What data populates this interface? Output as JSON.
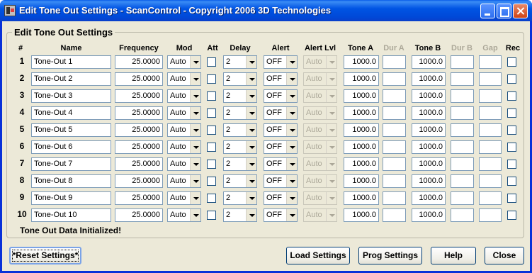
{
  "window": {
    "title": "Edit Tone Out Settings - ScanControl - Copyright 2006 3D Technologies"
  },
  "group": {
    "title": "Edit Tone Out Settings"
  },
  "headers": {
    "num": "#",
    "name": "Name",
    "frequency": "Frequency",
    "mod": "Mod",
    "att": "Att",
    "delay": "Delay",
    "alert": "Alert",
    "alert_lvl": "Alert Lvl",
    "tone_a": "Tone A",
    "dur_a": "Dur A",
    "tone_b": "Tone B",
    "dur_b": "Dur B",
    "gap": "Gap",
    "rec": "Rec"
  },
  "rows": [
    {
      "num": "1",
      "name": "Tone-Out 1",
      "frequency": "25.0000",
      "mod": "Auto",
      "delay": "2",
      "alert": "OFF",
      "alert_lvl": "Auto",
      "tone_a": "1000.0",
      "dur_a": "",
      "tone_b": "1000.0",
      "dur_b": "",
      "gap": ""
    },
    {
      "num": "2",
      "name": "Tone-Out 2",
      "frequency": "25.0000",
      "mod": "Auto",
      "delay": "2",
      "alert": "OFF",
      "alert_lvl": "Auto",
      "tone_a": "1000.0",
      "dur_a": "",
      "tone_b": "1000.0",
      "dur_b": "",
      "gap": ""
    },
    {
      "num": "3",
      "name": "Tone-Out 3",
      "frequency": "25.0000",
      "mod": "Auto",
      "delay": "2",
      "alert": "OFF",
      "alert_lvl": "Auto",
      "tone_a": "1000.0",
      "dur_a": "",
      "tone_b": "1000.0",
      "dur_b": "",
      "gap": ""
    },
    {
      "num": "4",
      "name": "Tone-Out 4",
      "frequency": "25.0000",
      "mod": "Auto",
      "delay": "2",
      "alert": "OFF",
      "alert_lvl": "Auto",
      "tone_a": "1000.0",
      "dur_a": "",
      "tone_b": "1000.0",
      "dur_b": "",
      "gap": ""
    },
    {
      "num": "5",
      "name": "Tone-Out 5",
      "frequency": "25.0000",
      "mod": "Auto",
      "delay": "2",
      "alert": "OFF",
      "alert_lvl": "Auto",
      "tone_a": "1000.0",
      "dur_a": "",
      "tone_b": "1000.0",
      "dur_b": "",
      "gap": ""
    },
    {
      "num": "6",
      "name": "Tone-Out 6",
      "frequency": "25.0000",
      "mod": "Auto",
      "delay": "2",
      "alert": "OFF",
      "alert_lvl": "Auto",
      "tone_a": "1000.0",
      "dur_a": "",
      "tone_b": "1000.0",
      "dur_b": "",
      "gap": ""
    },
    {
      "num": "7",
      "name": "Tone-Out 7",
      "frequency": "25.0000",
      "mod": "Auto",
      "delay": "2",
      "alert": "OFF",
      "alert_lvl": "Auto",
      "tone_a": "1000.0",
      "dur_a": "",
      "tone_b": "1000.0",
      "dur_b": "",
      "gap": ""
    },
    {
      "num": "8",
      "name": "Tone-Out 8",
      "frequency": "25.0000",
      "mod": "Auto",
      "delay": "2",
      "alert": "OFF",
      "alert_lvl": "Auto",
      "tone_a": "1000.0",
      "dur_a": "",
      "tone_b": "1000.0",
      "dur_b": "",
      "gap": ""
    },
    {
      "num": "9",
      "name": "Tone-Out 9",
      "frequency": "25.0000",
      "mod": "Auto",
      "delay": "2",
      "alert": "OFF",
      "alert_lvl": "Auto",
      "tone_a": "1000.0",
      "dur_a": "",
      "tone_b": "1000.0",
      "dur_b": "",
      "gap": ""
    },
    {
      "num": "10",
      "name": "Tone-Out 10",
      "frequency": "25.0000",
      "mod": "Auto",
      "delay": "2",
      "alert": "OFF",
      "alert_lvl": "Auto",
      "tone_a": "1000.0",
      "dur_a": "",
      "tone_b": "1000.0",
      "dur_b": "",
      "gap": ""
    }
  ],
  "status": "Tone Out Data Initialized!",
  "buttons": {
    "reset": "*Reset Settings*",
    "load": "Load Settings",
    "prog": "Prog Settings",
    "help": "Help",
    "close": "Close"
  }
}
